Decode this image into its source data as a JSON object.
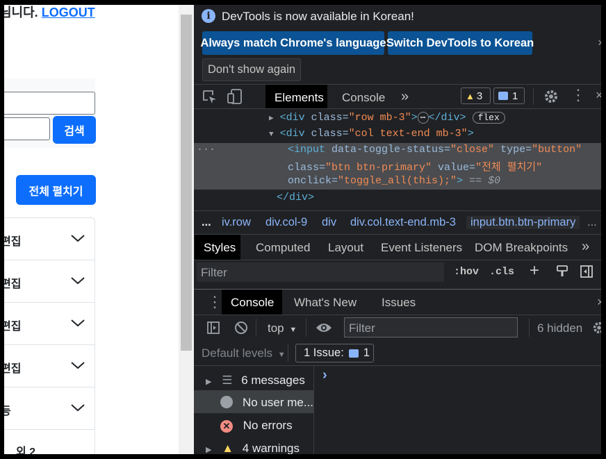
{
  "page": {
    "greeting": "님니다.",
    "logout": "LOGOUT",
    "search_btn": "검색",
    "expand_all_btn": "전체 펼치기",
    "accordion": [
      "편집",
      "편집",
      "편집",
      "편집",
      "등",
      "외 2"
    ]
  },
  "devtools": {
    "banner": {
      "message": "DevTools is now available in Korean!",
      "btn_match": "Always match Chrome's language",
      "btn_switch": "Switch DevTools to Korean",
      "btn_dont_show": "Don't show again",
      "close": "×"
    },
    "main_tabs": [
      "Elements",
      "Console",
      "»"
    ],
    "warnings_count": "3",
    "issues_count": "1",
    "dom": {
      "line1_tag_open": "<div ",
      "line1_attr": "class=",
      "line1_val": "\"row mb-3\"",
      "line1_close": ">",
      "line1_ellipsis": "⋯",
      "line1_end": "</div>",
      "line1_pill": "flex",
      "line2_tag_open": "<div ",
      "line2_attr": "class=",
      "line2_val": "\"col text-end mb-3\"",
      "line2_close": ">",
      "sel_dots": "...",
      "sel_l1_tag": "<input ",
      "sel_l1_a1": "data-toggle-status=",
      "sel_l1_v1": "\"close\"",
      "sel_l1_a2": " type=",
      "sel_l1_v2": "\"button\"",
      "sel_l2_a1": "class=",
      "sel_l2_v1": "\"btn btn-primary\"",
      "sel_l2_a2": " value=",
      "sel_l2_v2": "\"전체 펼치기\"",
      "sel_l3_a1": "onclick=",
      "sel_l3_v1": "\"toggle_all(this);\"",
      "sel_l3_close": ">",
      "sel_l3_eq": " == ",
      "sel_l3_dollar": "$0",
      "line_end_div": "</div>"
    },
    "breadcrumbs": [
      "...",
      "iv.row",
      "div.col-9",
      "div",
      "div.col.text-end.mb-3",
      "input.btn.btn-primary",
      "..."
    ],
    "style_tabs": [
      "Styles",
      "Computed",
      "Layout",
      "Event Listeners",
      "DOM Breakpoints",
      "»"
    ],
    "styles_filter_placeholder": "Filter",
    "hov": ":hov",
    "cls": ".cls",
    "drawer_tabs": [
      "Console",
      "What's New",
      "Issues"
    ],
    "console_toolbar": {
      "context": "top",
      "filter_placeholder": "Filter",
      "hidden": "6 hidden",
      "levels": "Default levels",
      "issue_label": "1 Issue:",
      "issue_count": "1"
    },
    "sidebar": [
      "6 messages",
      "No user me...",
      "No errors",
      "4 warnings"
    ],
    "prompt": "›"
  },
  "colors": {
    "bootstrap_primary": "#0d6efd",
    "devtools_bg": "#202124",
    "devtools_blue_btn": "#0b5394"
  }
}
